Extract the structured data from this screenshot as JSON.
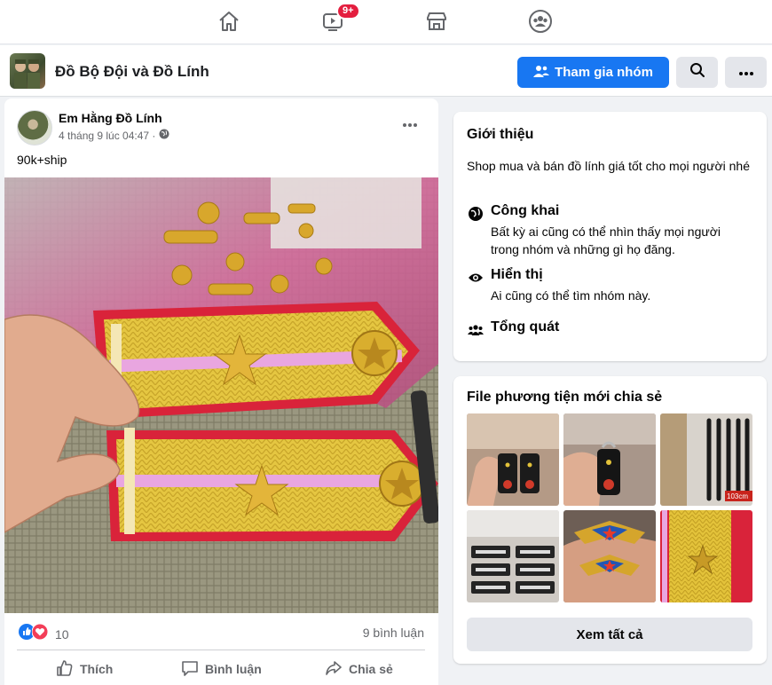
{
  "nav": {
    "icons": [
      "home-icon",
      "watch-icon",
      "marketplace-icon",
      "groups-icon"
    ],
    "watch_badge": "9+"
  },
  "group": {
    "title": "Đồ Bộ Đội và Đồ Lính",
    "join_label": "Tham gia nhóm"
  },
  "post": {
    "author": "Em Hằng Đồ Lính",
    "timestamp": "4 tháng 9 lúc 04:47 ·",
    "text": "90k+ship",
    "reaction_count": "10",
    "comment_count": "9 bình luận",
    "actions": {
      "like": "Thích",
      "comment": "Bình luận",
      "share": "Chia sẻ"
    }
  },
  "about": {
    "title": "Giới thiệu",
    "description": "Shop mua và bán đồ lính giá tốt cho mọi người nhé",
    "rows": [
      {
        "icon": "globe-icon",
        "title": "Công khai",
        "desc": "Bất kỳ ai cũng có thể nhìn thấy mọi người trong nhóm và những gì họ đăng."
      },
      {
        "icon": "eye-icon",
        "title": "Hiển thị",
        "desc": "Ai cũng có thể tìm nhóm này."
      },
      {
        "icon": "people-icon",
        "title": "Tổng quát",
        "desc": ""
      }
    ]
  },
  "media": {
    "title": "File phương tiện mới chia sẻ",
    "thumb_label": "103cm",
    "see_all": "Xem tất cả"
  },
  "colors": {
    "accent": "#1877f2",
    "epaulette_gold": "#e3c23a",
    "epaulette_red": "#d9233a",
    "stripe_pink": "#e9a6e0"
  }
}
